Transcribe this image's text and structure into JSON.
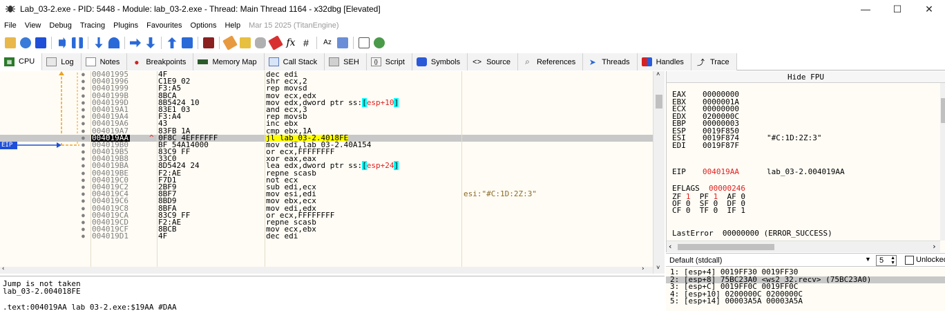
{
  "window": {
    "title": "Lab_03-2.exe - PID: 5448 - Module: lab_03-2.exe - Thread: Main Thread 1164 - x32dbg [Elevated]",
    "minimize": "—",
    "maximize": "☐",
    "close": "✕"
  },
  "menu": {
    "items": [
      "File",
      "View",
      "Debug",
      "Tracing",
      "Plugins",
      "Favourites",
      "Options",
      "Help"
    ],
    "date": "Mar 15 2025 (TitanEngine)"
  },
  "tabs": [
    {
      "label": "CPU",
      "icon": "cpu-icon"
    },
    {
      "label": "Log",
      "icon": "log-icon"
    },
    {
      "label": "Notes",
      "icon": "notes-icon"
    },
    {
      "label": "Breakpoints",
      "icon": "breakpoint-dot-icon"
    },
    {
      "label": "Memory Map",
      "icon": "memory-map-icon"
    },
    {
      "label": "Call Stack",
      "icon": "call-stack-icon"
    },
    {
      "label": "SEH",
      "icon": "seh-icon"
    },
    {
      "label": "Script",
      "icon": "script-icon"
    },
    {
      "label": "Symbols",
      "icon": "symbols-icon"
    },
    {
      "label": "Source",
      "icon": "source-icon"
    },
    {
      "label": "References",
      "icon": "search-icon"
    },
    {
      "label": "Threads",
      "icon": "threads-icon"
    },
    {
      "label": "Handles",
      "icon": "handles-icon"
    },
    {
      "label": "Trace",
      "icon": "trace-icon"
    }
  ],
  "disasm": {
    "eip_label": "EIP",
    "rows": [
      {
        "addr": "00401995",
        "bytes": "4F",
        "instr": "dec edi",
        "comment": ""
      },
      {
        "addr": "00401996",
        "bytes": "C1E9 02",
        "instr": "shr ecx,2",
        "comment": ""
      },
      {
        "addr": "00401999",
        "bytes": "F3:A5",
        "instr": "rep movsd",
        "comment": ""
      },
      {
        "addr": "0040199B",
        "bytes": "8BCA",
        "instr": "mov ecx,edx",
        "comment": ""
      },
      {
        "addr": "0040199D",
        "bytes": "8B5424 10",
        "instr": "mov edx,dword ptr ss:[esp+10]",
        "comment": ""
      },
      {
        "addr": "004019A1",
        "bytes": "83E1 03",
        "instr": "and ecx,3",
        "comment": ""
      },
      {
        "addr": "004019A4",
        "bytes": "F3:A4",
        "instr": "rep movsb",
        "comment": ""
      },
      {
        "addr": "004019A6",
        "bytes": "43",
        "instr": "inc ebx",
        "comment": ""
      },
      {
        "addr": "004019A7",
        "bytes": "83FB 1A",
        "instr": "cmp ebx,1A",
        "comment": ""
      },
      {
        "addr": "004019AA",
        "bytes": "0F8C 4EFFFFFF",
        "instr": "jl lab_03-2.4018FE",
        "comment": "",
        "current": true,
        "bytes_prefix": "^ "
      },
      {
        "addr": "004019B0",
        "bytes": "BF 54A14000",
        "instr": "mov edi,lab_03-2.40A154",
        "comment": ""
      },
      {
        "addr": "004019B5",
        "bytes": "83C9 FF",
        "instr": "or ecx,FFFFFFFF",
        "comment": ""
      },
      {
        "addr": "004019B8",
        "bytes": "33C0",
        "instr": "xor eax,eax",
        "comment": ""
      },
      {
        "addr": "004019BA",
        "bytes": "8D5424 24",
        "instr": "lea edx,dword ptr ss:[esp+24]",
        "comment": ""
      },
      {
        "addr": "004019BE",
        "bytes": "F2:AE",
        "instr": "repne scasb",
        "comment": ""
      },
      {
        "addr": "004019C0",
        "bytes": "F7D1",
        "instr": "not ecx",
        "comment": ""
      },
      {
        "addr": "004019C2",
        "bytes": "2BF9",
        "instr": "sub edi,ecx",
        "comment": ""
      },
      {
        "addr": "004019C4",
        "bytes": "8BF7",
        "instr": "mov esi,edi",
        "comment": "esi:\"#C:1D:2Z:3\""
      },
      {
        "addr": "004019C6",
        "bytes": "8BD9",
        "instr": "mov ebx,ecx",
        "comment": ""
      },
      {
        "addr": "004019C8",
        "bytes": "8BFA",
        "instr": "mov edi,edx",
        "comment": ""
      },
      {
        "addr": "004019CA",
        "bytes": "83C9 FF",
        "instr": "or ecx,FFFFFFFF",
        "comment": ""
      },
      {
        "addr": "004019CD",
        "bytes": "F2:AE",
        "instr": "repne scasb",
        "comment": ""
      },
      {
        "addr": "004019CF",
        "bytes": "8BCB",
        "instr": "mov ecx,ebx",
        "comment": ""
      },
      {
        "addr": "004019D1",
        "bytes": "4F",
        "instr": "dec edi",
        "comment": ""
      }
    ]
  },
  "info": {
    "line1": "Jump is not taken",
    "line2": "lab_03-2.004018FE",
    "line3": ".text:004019AA lab_03-2.exe:$19AA #DAA"
  },
  "registers": {
    "header": "Hide FPU",
    "gpr": [
      {
        "name": "EAX",
        "value": "00000000",
        "comment": ""
      },
      {
        "name": "EBX",
        "value": "0000001A",
        "comment": ""
      },
      {
        "name": "ECX",
        "value": "00000000",
        "comment": ""
      },
      {
        "name": "EDX",
        "value": "0200000C",
        "comment": ""
      },
      {
        "name": "EBP",
        "value": "00000003",
        "comment": ""
      },
      {
        "name": "ESP",
        "value": "0019F850",
        "comment": ""
      },
      {
        "name": "ESI",
        "value": "0019F874",
        "comment": "\"#C:1D:2Z:3\""
      },
      {
        "name": "EDI",
        "value": "0019F87F",
        "comment": ""
      }
    ],
    "eip": {
      "name": "EIP",
      "value": "004019AA",
      "comment": "lab_03-2.004019AA"
    },
    "eflags": {
      "name": "EFLAGS",
      "value": "00000246"
    },
    "flags_line1": "ZF 1  PF 1  AF 0",
    "flags_line2": "OF 0  SF 0  DF 0",
    "flags_line3": "CF 0  TF 0  IF 1",
    "lasterror": "LastError  00000000 (ERROR_SUCCESS)"
  },
  "callconv": {
    "selected": "Default (stdcall)",
    "count": "5",
    "unlocked_label": "Unlocked"
  },
  "args": [
    {
      "text": "1: [esp+4] 0019FF30 0019FF30",
      "selected": false
    },
    {
      "text": "2: [esp+8] 75BC23A0 <ws2_32.recv> (75BC23A0)",
      "selected": true
    },
    {
      "text": "3: [esp+C] 0019FF0C 0019FF0C",
      "selected": false
    },
    {
      "text": "4: [esp+10] 0200000C 0200000C",
      "selected": false
    },
    {
      "text": "5: [esp+14] 00003A5A 00003A5A",
      "selected": false
    }
  ],
  "colors": {
    "accent_blue": "#1f4fd8",
    "highlight_yellow": "#ffff00",
    "highlight_cyan": "#00ffff",
    "changed_red": "#e02020",
    "flow_orange": "#f0a020"
  }
}
